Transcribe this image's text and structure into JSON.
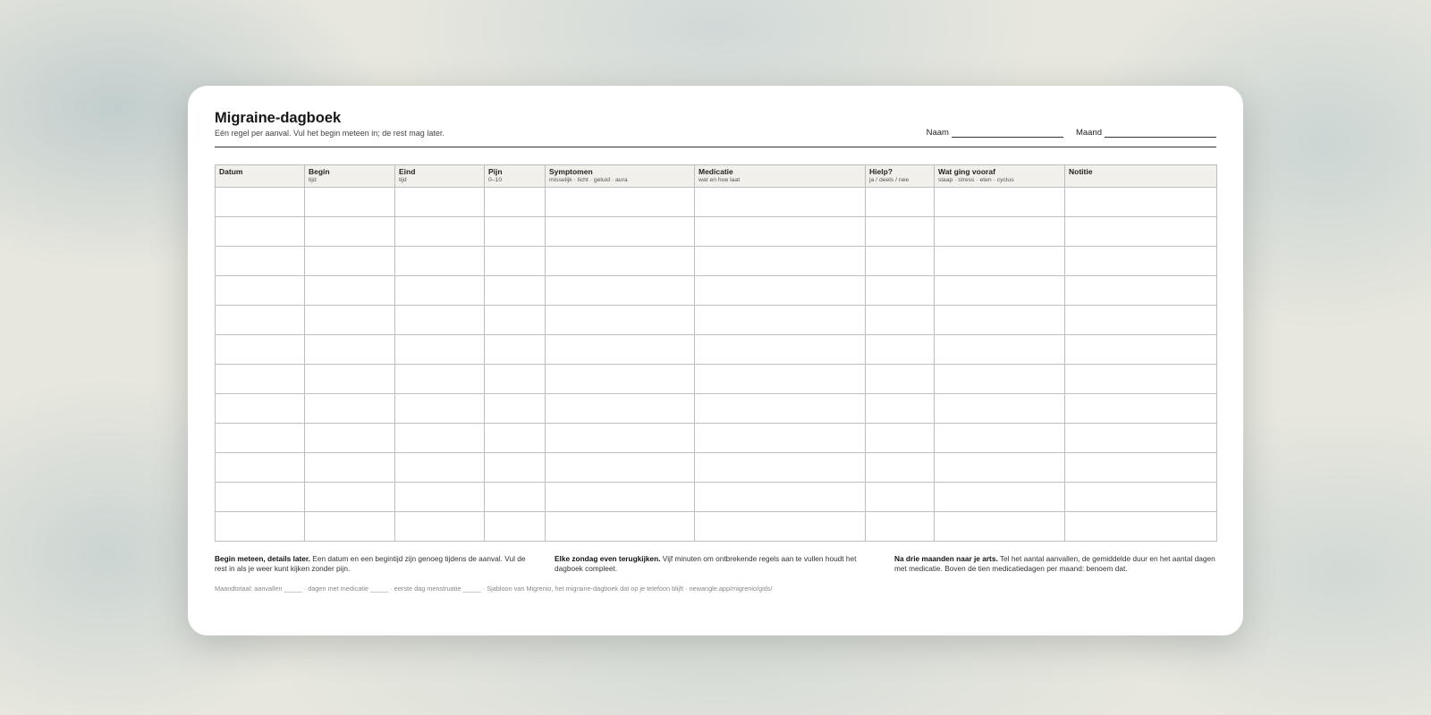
{
  "title": "Migraine-dagboek",
  "subtitle": "Eén regel per aanval. Vul het begin meteen in; de rest mag later.",
  "fields": [
    {
      "label": "Naam"
    },
    {
      "label": "Maand"
    }
  ],
  "columns": [
    {
      "label": "Datum",
      "sub": ""
    },
    {
      "label": "Begin",
      "sub": "tijd"
    },
    {
      "label": "Eind",
      "sub": "tijd"
    },
    {
      "label": "Pijn",
      "sub": "0–10"
    },
    {
      "label": "Symptomen",
      "sub": "misselijk · licht · geluid · aura"
    },
    {
      "label": "Medicatie",
      "sub": "wat en hoe laat"
    },
    {
      "label": "Hielp?",
      "sub": "ja / deels / nee"
    },
    {
      "label": "Wat ging vooraf",
      "sub": "slaap · stress · eten · cyclus"
    },
    {
      "label": "Notitie",
      "sub": ""
    }
  ],
  "empty_rows": 12,
  "notes": [
    {
      "bold": "Begin meteen, details later.",
      "text": " Een datum en een begintijd zijn genoeg tijdens de aanval. Vul de rest in als je weer kunt kijken zonder pijn."
    },
    {
      "bold": "Elke zondag even terugkijken.",
      "text": " Vijf minuten om ontbrekende regels aan te vullen houdt het dagboek compleet."
    },
    {
      "bold": "Na drie maanden naar je arts.",
      "text": " Tel het aantal aanvallen, de gemiddelde duur en het aantal dagen met medicatie. Boven de tien medicatiedagen per maand: benoem dat."
    }
  ],
  "footer": "Maandtotaal: aanvallen _____ · dagen met medicatie _____ · eerste dag menstruatie _____  ·  Sjabloon van Migrenio, het migraine-dagboek dat op je telefoon blijft · newangle.app/migrenio/gids/"
}
